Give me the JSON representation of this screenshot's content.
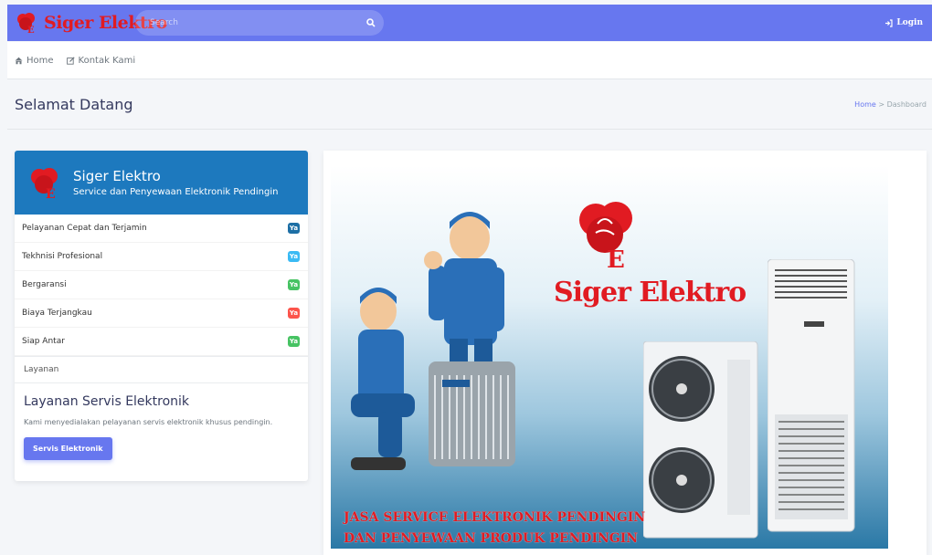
{
  "navbar": {
    "brand": "Siger Elektro",
    "search_placeholder": "Search",
    "login_label": "Login"
  },
  "subnav": {
    "items": [
      {
        "label": "Home",
        "icon": "home-icon"
      },
      {
        "label": "Kontak Kami",
        "icon": "edit-icon"
      }
    ]
  },
  "page_header": {
    "title": "Selamat Datang",
    "breadcrumb_home": "Home",
    "breadcrumb_sep": " > ",
    "breadcrumb_current": "Dashboard"
  },
  "profile_card": {
    "title": "Siger Elektro",
    "subtitle": "Service dan Penyewaan Elektronik Pendingin",
    "header_color": "#1d79be",
    "features": [
      {
        "label": "Pelayanan Cepat dan Terjamin",
        "badge": "Ya",
        "color": "#1d6fa5"
      },
      {
        "label": "Tekhnisi Profesional",
        "badge": "Ya",
        "color": "#3abaf4"
      },
      {
        "label": "Bergaransi",
        "badge": "Ya",
        "color": "#47c363"
      },
      {
        "label": "Biaya Terjangkau",
        "badge": "Ya",
        "color": "#fc544b"
      },
      {
        "label": "Siap Antar",
        "badge": "Ya",
        "color": "#47c363"
      }
    ],
    "tab_label": "Layanan",
    "service_title": "Layanan Servis Elektronik",
    "service_text": "Kami menyedialakan pelayanan servis elektronik khusus pendingin.",
    "service_button": "Servis Elektronik"
  },
  "banner": {
    "brand": "Siger Elektro",
    "line1": "JASA SERVICE ELEKTRONIK PENDINGIN",
    "line2": "DAN PENYEWAAN PRODUK PENDINGIN"
  },
  "colors": {
    "primary": "#6777ef",
    "brand_red": "#e11b22"
  }
}
